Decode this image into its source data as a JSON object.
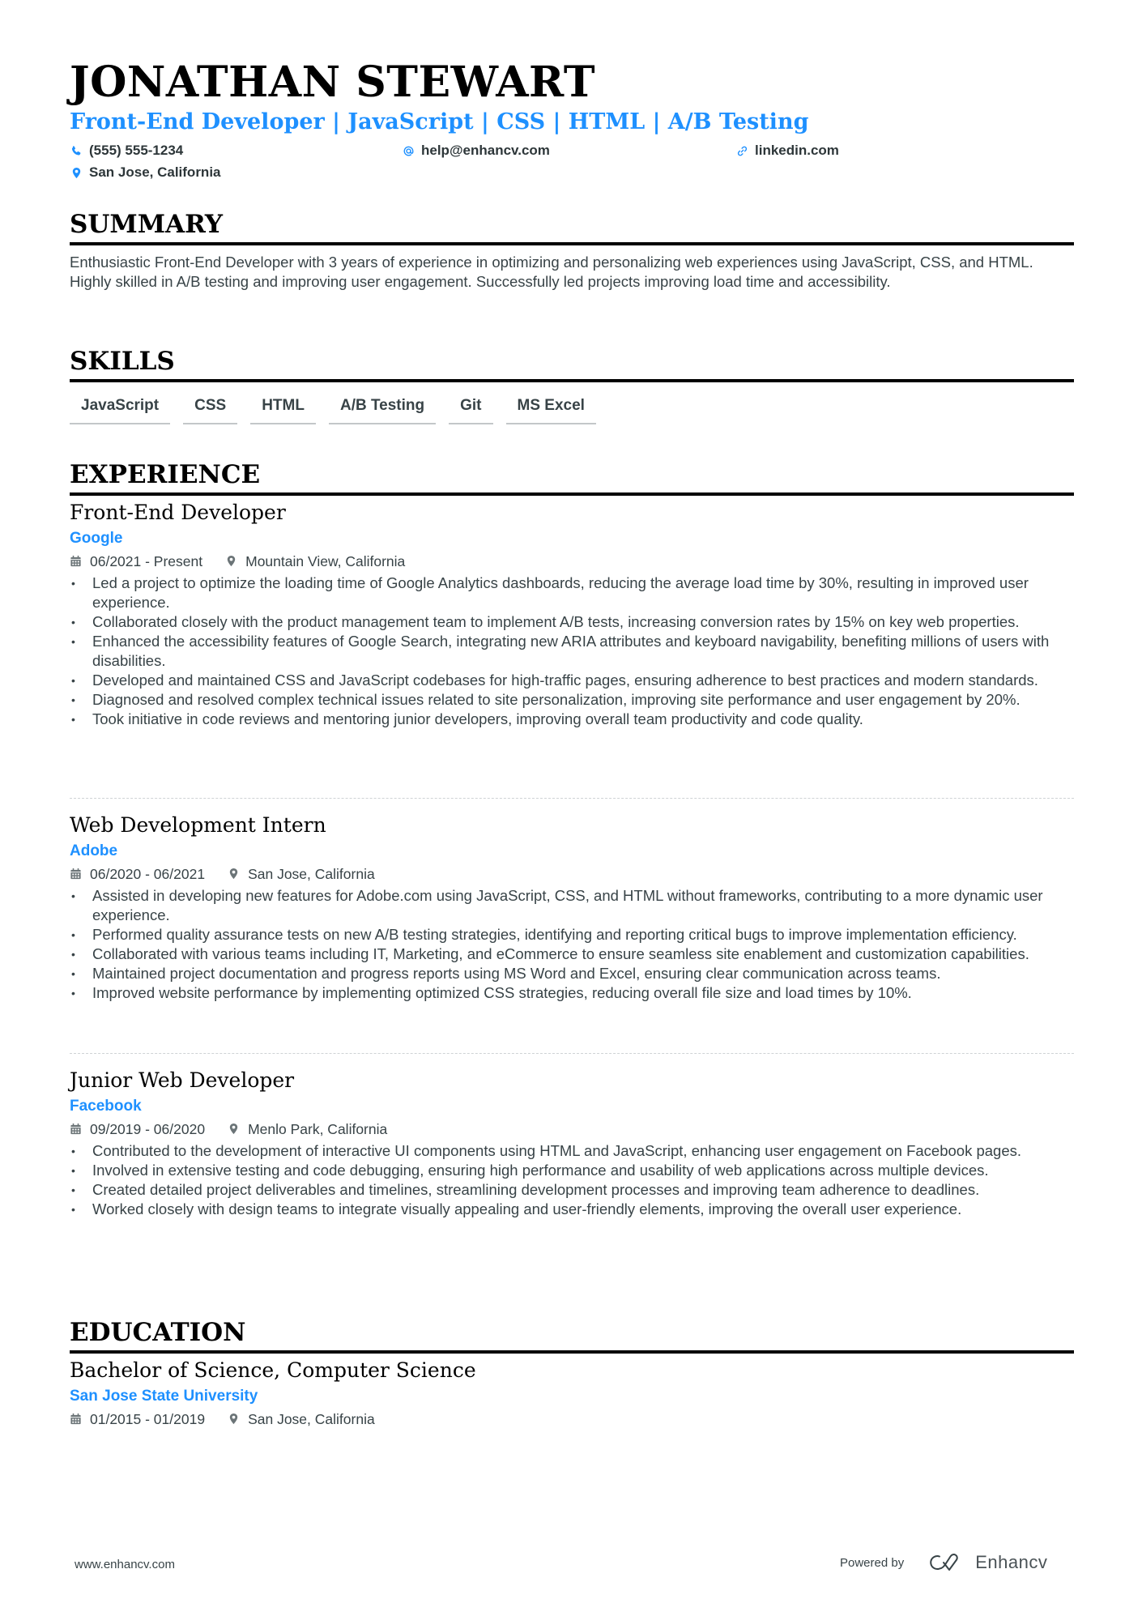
{
  "header": {
    "name": "JONATHAN STEWART",
    "subtitle": "Front-End Developer | JavaScript | CSS | HTML | A/B Testing",
    "contacts": [
      {
        "icon": "phone-icon",
        "text": "(555) 555-1234"
      },
      {
        "icon": "at-icon",
        "text": "help@enhancv.com"
      },
      {
        "icon": "link-icon",
        "text": "linkedin.com"
      },
      {
        "icon": "location-pin-icon",
        "text": "San Jose, California"
      }
    ]
  },
  "summary": {
    "title": "SUMMARY",
    "text": "Enthusiastic Front-End Developer with 3 years of experience in optimizing and personalizing web experiences using JavaScript, CSS, and HTML. Highly skilled in A/B testing and improving user engagement. Successfully led projects improving load time and accessibility."
  },
  "skills": {
    "title": "SKILLS",
    "items": [
      "JavaScript",
      "CSS",
      "HTML",
      "A/B Testing",
      "Git",
      "MS Excel"
    ]
  },
  "experience": {
    "title": "EXPERIENCE",
    "jobs": [
      {
        "role": "Front-End Developer",
        "company": "Google",
        "dates": "06/2021 - Present",
        "location": "Mountain View, California",
        "bullets": [
          "Led a project to optimize the loading time of Google Analytics dashboards, reducing the average load time by 30%, resulting in improved user experience.",
          "Collaborated closely with the product management team to implement A/B tests, increasing conversion rates by 15% on key web properties.",
          "Enhanced the accessibility features of Google Search, integrating new ARIA attributes and keyboard navigability, benefiting millions of users with disabilities.",
          "Developed and maintained CSS and JavaScript codebases for high-traffic pages, ensuring adherence to best practices and modern standards.",
          "Diagnosed and resolved complex technical issues related to site personalization, improving site performance and user engagement by 20%.",
          "Took initiative in code reviews and mentoring junior developers, improving overall team productivity and code quality."
        ]
      },
      {
        "role": "Web Development Intern",
        "company": "Adobe",
        "dates": "06/2020 - 06/2021",
        "location": "San Jose, California",
        "bullets": [
          "Assisted in developing new features for Adobe.com using JavaScript, CSS, and HTML without frameworks, contributing to a more dynamic user experience.",
          "Performed quality assurance tests on new A/B testing strategies, identifying and reporting critical bugs to improve implementation efficiency.",
          "Collaborated with various teams including IT, Marketing, and eCommerce to ensure seamless site enablement and customization capabilities.",
          "Maintained project documentation and progress reports using MS Word and Excel, ensuring clear communication across teams.",
          "Improved website performance by implementing optimized CSS strategies, reducing overall file size and load times by 10%."
        ]
      },
      {
        "role": "Junior Web Developer",
        "company": "Facebook",
        "dates": "09/2019 - 06/2020",
        "location": "Menlo Park, California",
        "bullets": [
          "Contributed to the development of interactive UI components using HTML and JavaScript, enhancing user engagement on Facebook pages.",
          "Involved in extensive testing and code debugging, ensuring high performance and usability of web applications across multiple devices.",
          "Created detailed project deliverables and timelines, streamlining development processes and improving team adherence to deadlines.",
          "Worked closely with design teams to integrate visually appealing and user-friendly elements, improving the overall user experience."
        ]
      }
    ]
  },
  "education": {
    "title": "EDUCATION",
    "degree": "Bachelor of Science, Computer Science",
    "school": "San Jose State University",
    "dates": "01/2015 - 01/2019",
    "location": "San Jose, California"
  },
  "footer": {
    "website": "www.enhancv.com",
    "powered_by": "Powered by",
    "brand": "Enhancv"
  },
  "colors": {
    "accent": "#1e90ff",
    "text": "#384347",
    "heading": "#000000"
  }
}
